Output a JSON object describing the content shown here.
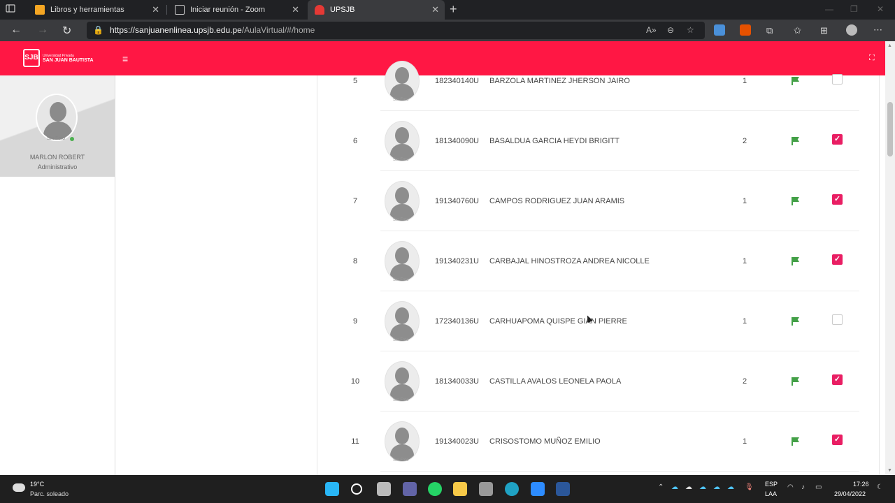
{
  "browser": {
    "tabs": [
      {
        "label": "Libros y herramientas",
        "favicon_color": "#f5a623"
      },
      {
        "label": "Iniciar reunión - Zoom",
        "favicon_color": "#cccccc"
      },
      {
        "label": "UPSJB",
        "favicon_color": "#e53935"
      }
    ],
    "new_tab": "+",
    "url_host": "https://sanjuanenlinea.upsjb.edu.pe",
    "url_path": "/AulaVirtual/#/home"
  },
  "app": {
    "brand_sub": "Universidad Privada",
    "brand_name": "SAN JUAN BAUTISTA",
    "accent_color": "#ff1744"
  },
  "user": {
    "photo_caption": "Sin Foto",
    "name": "MARLON ROBERT",
    "role": "Administrativo"
  },
  "students": [
    {
      "num": "5",
      "code": "182340140U",
      "name": "BARZOLA MARTINEZ JHERSON JAIRO",
      "count": "1",
      "checked": false,
      "photo_caption": "Sin Foto"
    },
    {
      "num": "6",
      "code": "181340090U",
      "name": "BASALDUA GARCIA HEYDI BRIGITT",
      "count": "2",
      "checked": true,
      "photo_caption": "Sin Foto"
    },
    {
      "num": "7",
      "code": "191340760U",
      "name": "CAMPOS RODRIGUEZ JUAN ARAMIS",
      "count": "1",
      "checked": true,
      "photo_caption": "Sin Foto"
    },
    {
      "num": "8",
      "code": "191340231U",
      "name": "CARBAJAL HINOSTROZA ANDREA NICOLLE",
      "count": "1",
      "checked": true,
      "photo_caption": "Sin Foto"
    },
    {
      "num": "9",
      "code": "172340136U",
      "name": "CARHUAPOMA QUISPE GIAN PIERRE",
      "count": "1",
      "checked": false,
      "photo_caption": "Sin Foto"
    },
    {
      "num": "10",
      "code": "181340033U",
      "name": "CASTILLA AVALOS LEONELA PAOLA",
      "count": "2",
      "checked": true,
      "photo_caption": "Sin Foto"
    },
    {
      "num": "11",
      "code": "191340023U",
      "name": "CRISOSTOMO MUÑOZ EMILIO",
      "count": "1",
      "checked": true,
      "photo_caption": "Sin Foto"
    }
  ],
  "taskbar": {
    "temperature": "19°C",
    "condition": "Parc. soleado",
    "lang1": "ESP",
    "lang2": "LAA",
    "time": "17:26",
    "date": "29/04/2022"
  }
}
